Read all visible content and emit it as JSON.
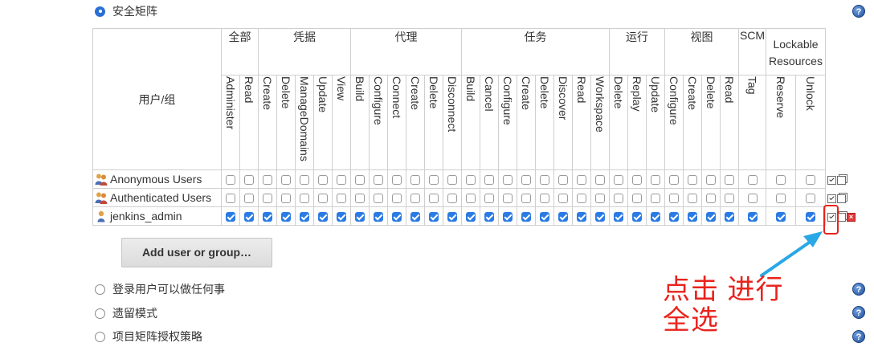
{
  "strategy_options": {
    "matrix": "安全矩阵",
    "logged_in": "登录用户可以做任何事",
    "legacy": "遗留模式",
    "project_matrix": "项目矩阵授权策略"
  },
  "table": {
    "user_header": "用户/组",
    "groups": [
      {
        "label": "全部",
        "span": 2
      },
      {
        "label": "凭据",
        "span": 5
      },
      {
        "label": "代理",
        "span": 6
      },
      {
        "label": "任务",
        "span": 8
      },
      {
        "label": "运行",
        "span": 3
      },
      {
        "label": "视图",
        "span": 4
      },
      {
        "label": "SCM",
        "span": 1
      },
      {
        "label": "Lockable Resources",
        "span": 2
      }
    ],
    "permissions": [
      "Administer",
      "Read",
      "Create",
      "Delete",
      "ManageDomains",
      "Update",
      "View",
      "Build",
      "Configure",
      "Connect",
      "Create",
      "Delete",
      "Disconnect",
      "Build",
      "Cancel",
      "Configure",
      "Create",
      "Delete",
      "Discover",
      "Read",
      "Workspace",
      "Delete",
      "Replay",
      "Update",
      "Configure",
      "Create",
      "Delete",
      "Read",
      "Tag",
      "Reserve",
      "Unlock"
    ],
    "rows": [
      {
        "name": "Anonymous Users",
        "icon": "group-icon",
        "checked": false,
        "deletable": false
      },
      {
        "name": "Authenticated Users",
        "icon": "group-icon",
        "checked": false,
        "deletable": false
      },
      {
        "name": "jenkins_admin",
        "icon": "user-icon",
        "checked": true,
        "deletable": true
      }
    ]
  },
  "add_button": "Add user or group…",
  "help_icon": "?",
  "annotation": {
    "line1": "点击 进行",
    "line2": "全选",
    "color": "#e8231c",
    "arrow_color": "#2aa8e6"
  }
}
